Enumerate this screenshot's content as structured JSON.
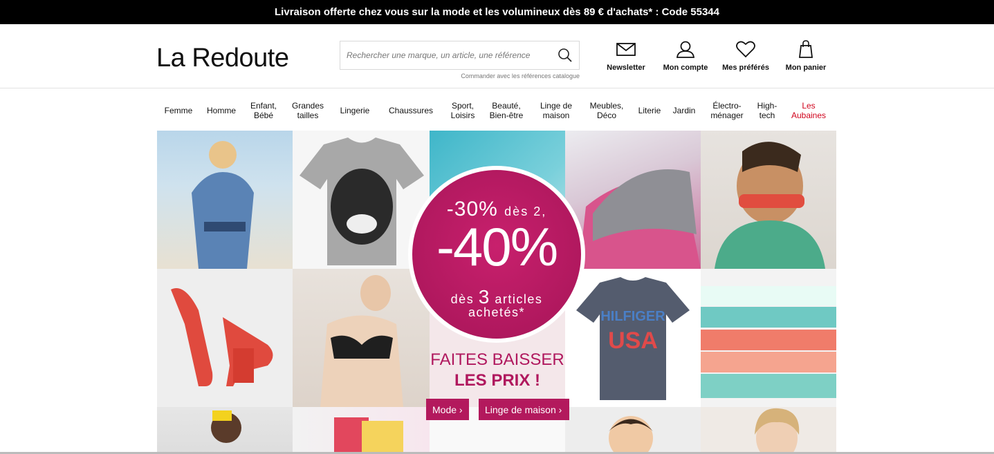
{
  "promo": {
    "text": "Livraison offerte chez vous sur la mode et les volumineux dès 89 € d'achats* : Code 55344"
  },
  "header": {
    "logo": "La Redoute",
    "search_placeholder": "Rechercher une marque, un article, une référence",
    "catalog_link": "Commander avec les références catalogue",
    "actions": [
      {
        "label": "Newsletter",
        "icon": "envelope-icon"
      },
      {
        "label": "Mon compte",
        "icon": "user-icon"
      },
      {
        "label": "Mes préférés",
        "icon": "heart-icon"
      },
      {
        "label": "Mon panier",
        "icon": "shopping-bag-icon"
      }
    ]
  },
  "nav": {
    "items": [
      "Femme",
      "Homme",
      "Enfant,\nBébé",
      "Grandes\ntailles",
      "Lingerie",
      "Chaussures",
      "Sport,\nLoisirs",
      "Beauté,\nBien-être",
      "Linge de\nmaison",
      "Meubles,\nDéco",
      "Literie",
      "Jardin",
      "Électro-\nménager",
      "High-\ntech",
      "Les\nAubaines"
    ],
    "accent_color": "#d0021b"
  },
  "banner": {
    "line1_pct": "-30%",
    "line1_rest": "dès 2,",
    "line2_pct": "-40%",
    "line3_pre": "dès",
    "line3_num": "3",
    "line3_post": "articles",
    "line4": "achetés*",
    "headline1": "FAITES BAISSER",
    "headline2": "LES PRIX !",
    "cta_mode": "Mode ›",
    "cta_linge": "Linge de maison ›",
    "brand_color": "#b3195d"
  }
}
